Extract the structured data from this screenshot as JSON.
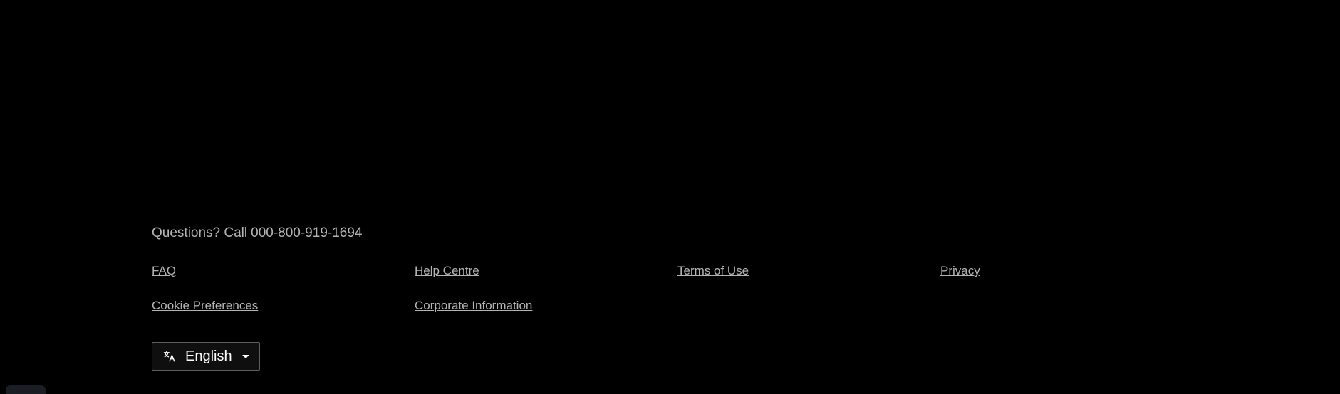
{
  "footer": {
    "questions_text": "Questions? Call",
    "phone": "000-800-919-1694",
    "links": [
      {
        "label": "FAQ"
      },
      {
        "label": "Help Centre"
      },
      {
        "label": "Terms of Use"
      },
      {
        "label": "Privacy"
      },
      {
        "label": "Cookie Preferences"
      },
      {
        "label": "Corporate Information"
      }
    ],
    "language": {
      "selected": "English",
      "icon": "language-icon"
    }
  },
  "colors": {
    "background": "#000000",
    "text_muted": "rgba(255,255,255,0.7)",
    "text_primary": "#ffffff"
  }
}
